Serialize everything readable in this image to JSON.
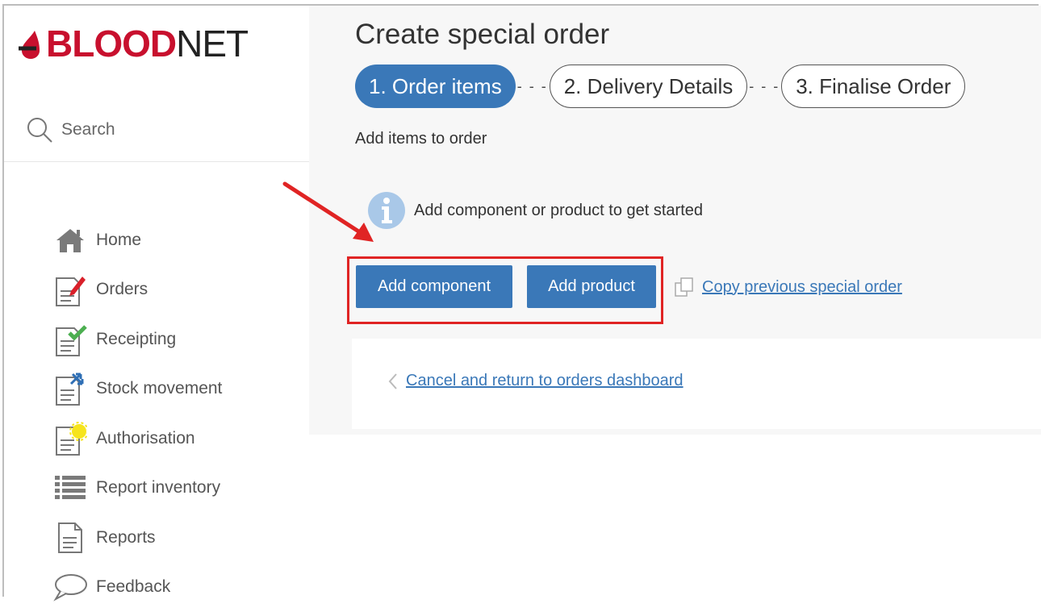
{
  "brand": {
    "word1": "BLOOD",
    "word2": "NET"
  },
  "search": {
    "label": "Search"
  },
  "sidebar": {
    "items": [
      {
        "label": "Home",
        "icon": "home-icon"
      },
      {
        "label": "Orders",
        "icon": "orders-icon"
      },
      {
        "label": "Receipting",
        "icon": "receipting-icon"
      },
      {
        "label": "Stock movement",
        "icon": "stock-movement-icon"
      },
      {
        "label": "Authorisation",
        "icon": "authorisation-icon"
      },
      {
        "label": "Report inventory",
        "icon": "report-inventory-icon"
      },
      {
        "label": "Reports",
        "icon": "reports-icon"
      },
      {
        "label": "Feedback",
        "icon": "feedback-icon"
      }
    ]
  },
  "main": {
    "title": "Create special order",
    "steps": [
      {
        "label": "1. Order items",
        "state": "active"
      },
      {
        "label": "2. Delivery Details",
        "state": "inactive"
      },
      {
        "label": "3. Finalise Order",
        "state": "inactive"
      }
    ],
    "step_separator": "- - -",
    "subtitle": "Add items to order",
    "info_text": "Add component or product to get started",
    "add_component_label": "Add component",
    "add_product_label": "Add product",
    "copy_previous_label": "Copy previous special order",
    "cancel_label": "Cancel and return to orders dashboard"
  },
  "colors": {
    "accent": "#3a78b8",
    "brand_red": "#c8102e",
    "annotation_red": "#e02424"
  }
}
